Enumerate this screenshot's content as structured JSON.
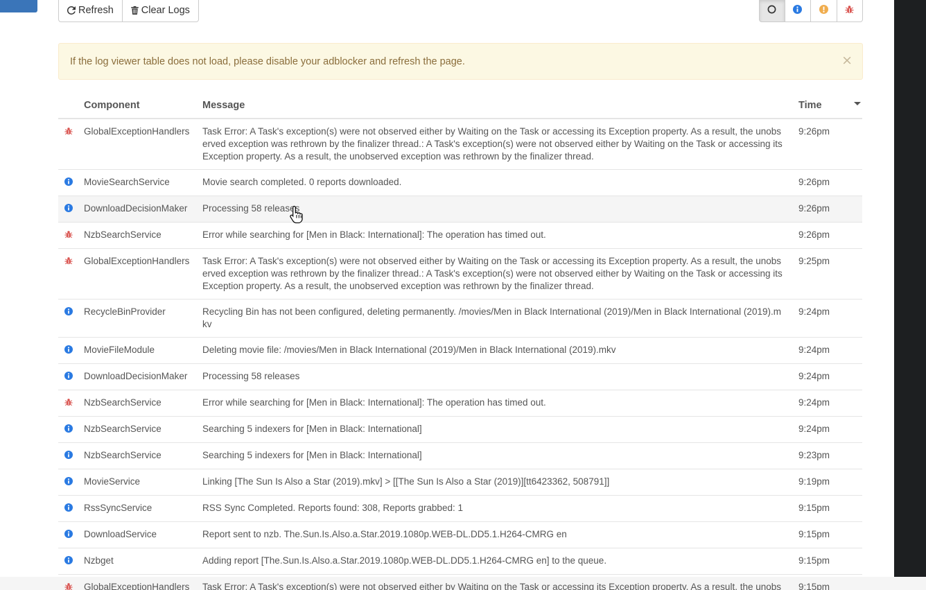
{
  "toolbar": {
    "refresh_label": "Refresh",
    "clear_label": "Clear Logs"
  },
  "filters": [
    {
      "name": "all",
      "icon": "circle-icon",
      "color": "#333333",
      "active": true
    },
    {
      "name": "info",
      "icon": "info-icon",
      "color": "#2a7ae2",
      "active": false
    },
    {
      "name": "warn",
      "icon": "warning-icon",
      "color": "#f0ad4e",
      "active": false
    },
    {
      "name": "error",
      "icon": "bug-icon",
      "color": "#d9534f",
      "active": false
    }
  ],
  "alert": {
    "text": "If the log viewer table does not load, please disable your adblocker and refresh the page.",
    "close": "×"
  },
  "table": {
    "headers": {
      "component": "Component",
      "message": "Message",
      "time": "Time"
    },
    "rows": [
      {
        "level": "error",
        "component": "GlobalExceptionHandlers",
        "message": "Task Error: A Task's exception(s) were not observed either by Waiting on the Task or accessing its Exception property. As a result, the unobserved exception was rethrown by the finalizer thread.: A Task's exception(s) were not observed either by Waiting on the Task or accessing its Exception property. As a result, the unobserved exception was rethrown by the finalizer thread.",
        "time": "9:26pm"
      },
      {
        "level": "info",
        "component": "MovieSearchService",
        "message": "Movie search completed. 0 reports downloaded.",
        "time": "9:26pm"
      },
      {
        "level": "info",
        "component": "DownloadDecisionMaker",
        "message": "Processing 58 releases",
        "time": "9:26pm"
      },
      {
        "level": "error",
        "component": "NzbSearchService",
        "message": "Error while searching for [Men in Black: International]: The operation has timed out.",
        "time": "9:26pm"
      },
      {
        "level": "error",
        "component": "GlobalExceptionHandlers",
        "message": "Task Error: A Task's exception(s) were not observed either by Waiting on the Task or accessing its Exception property. As a result, the unobserved exception was rethrown by the finalizer thread.: A Task's exception(s) were not observed either by Waiting on the Task or accessing its Exception property. As a result, the unobserved exception was rethrown by the finalizer thread.",
        "time": "9:25pm"
      },
      {
        "level": "info",
        "component": "RecycleBinProvider",
        "message": "Recycling Bin has not been configured, deleting permanently. /movies/Men in Black International (2019)/Men in Black International (2019).mkv",
        "time": "9:24pm"
      },
      {
        "level": "info",
        "component": "MovieFileModule",
        "message": "Deleting movie file: /movies/Men in Black International (2019)/Men in Black International (2019).mkv",
        "time": "9:24pm"
      },
      {
        "level": "info",
        "component": "DownloadDecisionMaker",
        "message": "Processing 58 releases",
        "time": "9:24pm"
      },
      {
        "level": "error",
        "component": "NzbSearchService",
        "message": "Error while searching for [Men in Black: International]: The operation has timed out.",
        "time": "9:24pm"
      },
      {
        "level": "info",
        "component": "NzbSearchService",
        "message": "Searching 5 indexers for [Men in Black: International]",
        "time": "9:24pm"
      },
      {
        "level": "info",
        "component": "NzbSearchService",
        "message": "Searching 5 indexers for [Men in Black: International]",
        "time": "9:23pm"
      },
      {
        "level": "info",
        "component": "MovieService",
        "message": "Linking [The Sun Is Also a Star (2019).mkv] > [[The Sun Is Also a Star (2019)][tt6423362, 508791]]",
        "time": "9:19pm"
      },
      {
        "level": "info",
        "component": "RssSyncService",
        "message": "RSS Sync Completed. Reports found: 308, Reports grabbed: 1",
        "time": "9:15pm"
      },
      {
        "level": "info",
        "component": "DownloadService",
        "message": "Report sent to nzb. The.Sun.Is.Also.a.Star.2019.1080p.WEB-DL.DD5.1.H264-CMRG en",
        "time": "9:15pm"
      },
      {
        "level": "info",
        "component": "Nzbget",
        "message": "Adding report [The.Sun.Is.Also.a.Star.2019.1080p.WEB-DL.DD5.1.H264-CMRG en] to the queue.",
        "time": "9:15pm"
      },
      {
        "level": "error",
        "component": "GlobalExceptionHandlers",
        "message": "Task Error: A Task's exception(s) were not observed either by Waiting on the Task or accessing its Exception property. As a result, the unobs",
        "time": "9:15pm"
      }
    ]
  },
  "colors": {
    "info": "#2a7ae2",
    "error": "#d9534f",
    "warn": "#f0ad4e",
    "alert_bg": "#fcf8e3",
    "alert_text": "#8a6d3b"
  }
}
